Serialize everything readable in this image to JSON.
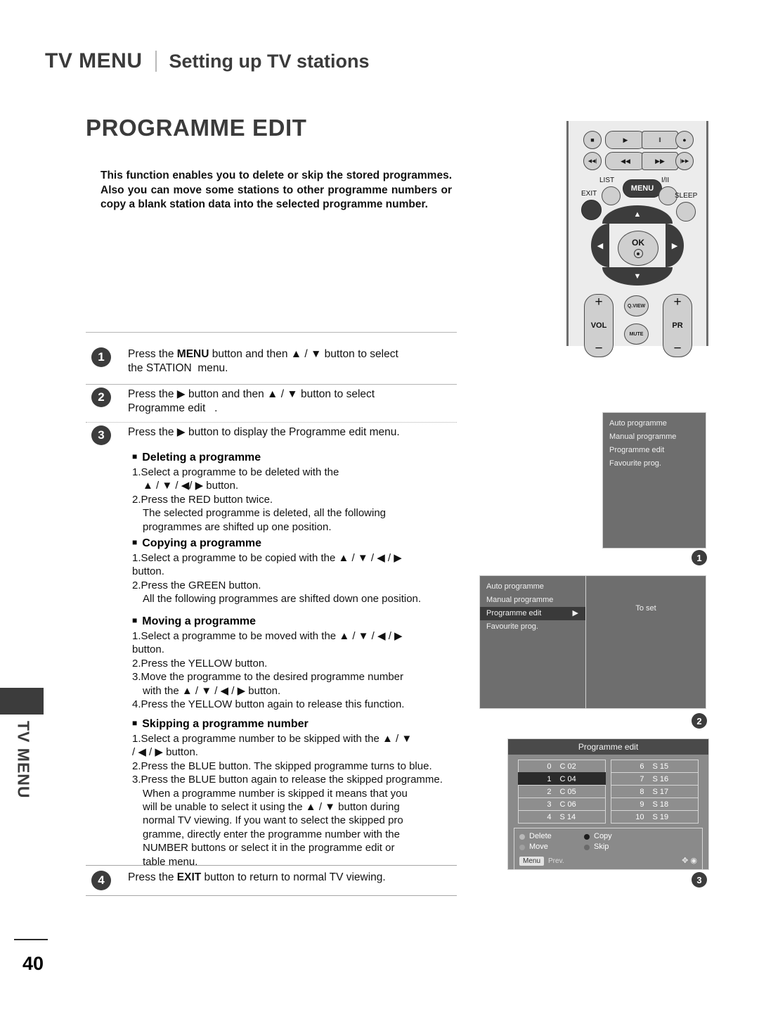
{
  "header": {
    "main": "TV MENU",
    "sub": "Setting up TV stations"
  },
  "title": "PROGRAMME EDIT",
  "intro": "This function enables you to delete or skip the stored programmes. Also you can move some stations to other programme numbers or copy a blank station data into the selected programme number.",
  "steps": [
    {
      "num": "1",
      "text": "Press the MENU button and then ▲ / ▼ button to select the STATION  menu.",
      "pre": "Press the ",
      "bold": "MENU",
      "post": " button and then ▲ / ▼ button to select the STATION  menu."
    },
    {
      "num": "2",
      "pre": "Press the ▶ button and then ▲ / ▼ button to select Programme edit   ."
    },
    {
      "num": "3",
      "pre": "Press the ▶ button to display the Programme edit menu."
    },
    {
      "num": "4",
      "pre": "Press the ",
      "bold": "EXIT",
      "post": " button to return to normal TV viewing."
    }
  ],
  "sections": [
    {
      "heading": "Deleting a programme",
      "lines": [
        "1.Select a programme to be deleted with the",
        "▲ / ▼ / ◀/ ▶ button.",
        "2.Press the RED button twice.",
        "The selected programme is deleted, all the following",
        "programmes are shifted up one position."
      ],
      "indent": [
        false,
        true,
        false,
        true,
        true
      ]
    },
    {
      "heading": "Copying a programme",
      "lines": [
        "1.Select a programme to be copied with the ▲ / ▼ / ◀ / ▶",
        "button.",
        "2.Press the GREEN button.",
        "All the following programmes are shifted down one position."
      ],
      "indent": [
        false,
        true,
        false,
        true
      ]
    },
    {
      "heading": "Moving a programme",
      "lines": [
        "1.Select a programme to be moved with the ▲ / ▼ / ◀ / ▶",
        "button.",
        "2.Press the YELLOW button.",
        "3.Move the programme to the desired programme number",
        "with the ▲ / ▼ / ◀ / ▶ button.",
        "4.Press the YELLOW button again to release this function."
      ],
      "indent": [
        false,
        true,
        false,
        false,
        true,
        false
      ]
    },
    {
      "heading": "Skipping a programme number",
      "lines": [
        "1.Select a programme number to be skipped with the ▲ / ▼",
        "/ ◀ / ▶ button.",
        "2.Press the BLUE button. The skipped programme turns to blue.",
        "3.Press the BLUE button again to release the skipped programme.",
        "When a programme number is skipped it means that you",
        "will be unable to select it using the ▲ / ▼ button during",
        "normal TV viewing. If you want to select the skipped pro",
        "gramme, directly enter the programme number with the",
        "NUMBER buttons or select it in the programme edit or",
        "table menu."
      ],
      "indent": [
        false,
        false,
        false,
        false,
        true,
        true,
        true,
        true,
        true,
        true
      ]
    }
  ],
  "side_tab": "TV MENU",
  "page_number": "40",
  "remote": {
    "labels": {
      "list": "LIST",
      "menu": "MENU",
      "i_ii": "I/II",
      "exit": "EXIT",
      "sleep": "SLEEP",
      "ok": "OK",
      "vol": "VOL",
      "pr": "PR",
      "qview": "Q.VIEW",
      "mute": "MUTE",
      "plus": "+",
      "minus": "−"
    },
    "transport": {
      "stop": "■",
      "play": "▶",
      "pause": "‖",
      "record": "●",
      "prev": "◀◀|",
      "rew": "◀◀",
      "ff": "▶▶",
      "next": "|▶▶"
    },
    "dpad": {
      "up": "▲",
      "down": "▼",
      "left": "◀",
      "right": "▶"
    }
  },
  "osd1": {
    "items": [
      "Auto programme",
      "Manual programme",
      "Programme edit",
      "Favourite prog."
    ],
    "callout": "1"
  },
  "osd2": {
    "items": [
      "Auto programme",
      "Manual programme",
      "Programme edit",
      "Favourite prog."
    ],
    "selected_index": 2,
    "selected_arrow": "▶",
    "right_label": "To set",
    "callout": "2"
  },
  "osd3": {
    "title": "Programme edit",
    "left_column": [
      {
        "num": "0",
        "val": "C  02",
        "selected": false
      },
      {
        "num": "1",
        "val": "C  04",
        "selected": true
      },
      {
        "num": "2",
        "val": "C  05",
        "selected": false
      },
      {
        "num": "3",
        "val": "C  06",
        "selected": false
      },
      {
        "num": "4",
        "val": "S  14",
        "selected": false
      }
    ],
    "right_column": [
      {
        "num": "6",
        "val": "S  15",
        "selected": false
      },
      {
        "num": "7",
        "val": "S  16",
        "selected": false
      },
      {
        "num": "8",
        "val": "S  17",
        "selected": false
      },
      {
        "num": "9",
        "val": "S  18",
        "selected": false
      },
      {
        "num": "10",
        "val": "S  19",
        "selected": false
      }
    ],
    "actions": [
      {
        "label": "Delete",
        "color": "#b9b9b9"
      },
      {
        "label": "Copy",
        "color": "#1c1c1c"
      },
      {
        "label": "Move",
        "color": "#a0a0a0"
      },
      {
        "label": "Skip",
        "color": "#6a6a6a"
      }
    ],
    "menu_chip": "Menu",
    "prev_label": "Prev.",
    "nav_glyphs": "✥ ◉",
    "callout": "3"
  }
}
